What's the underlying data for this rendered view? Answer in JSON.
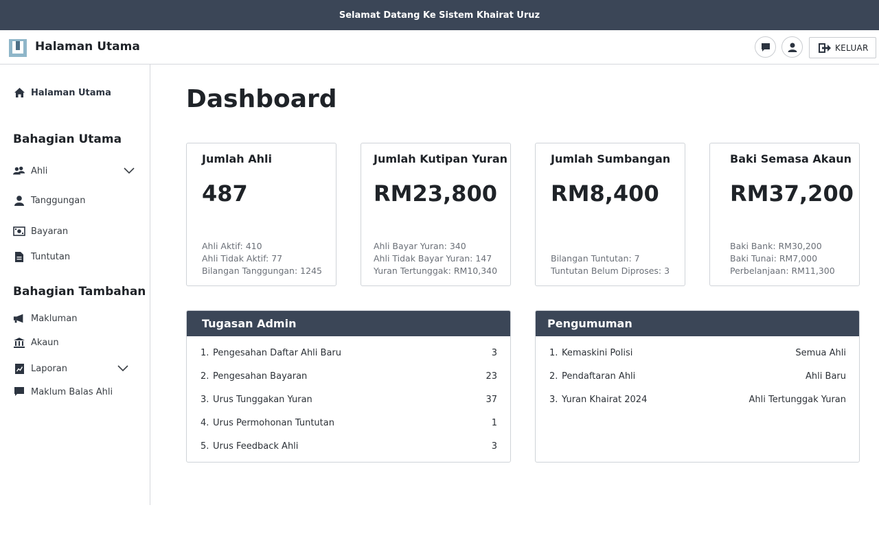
{
  "topbar": {
    "welcome": "Selamat Datang Ke Sistem Khairat Uruz"
  },
  "header": {
    "title": "Halaman Utama",
    "logout_label": "KELUAR",
    "icons": {
      "messages": "chat-icon",
      "profile": "user-icon",
      "logout": "logout-icon"
    }
  },
  "sidebar": {
    "home": {
      "label": "Halaman Utama",
      "icon": "home-icon"
    },
    "section_main": "Bahagian Utama",
    "main_items": [
      {
        "label": "Ahli",
        "icon": "users-icon",
        "expandable": true
      },
      {
        "label": "Tanggungan",
        "icon": "user-icon"
      },
      {
        "label": "Bayaran",
        "icon": "money-icon"
      },
      {
        "label": "Tuntutan",
        "icon": "document-icon"
      }
    ],
    "section_extra": "Bahagian Tambahan",
    "extra_items": [
      {
        "label": "Makluman",
        "icon": "megaphone-icon"
      },
      {
        "label": "Akaun",
        "icon": "bank-icon"
      },
      {
        "label": "Laporan",
        "icon": "report-icon",
        "expandable": true
      },
      {
        "label": "Maklum Balas Ahli",
        "icon": "chat-icon"
      }
    ]
  },
  "main": {
    "title": "Dashboard",
    "cards": [
      {
        "title": "Jumlah Ahli",
        "value": "487",
        "details": [
          "Ahli Aktif: 410",
          "Ahli Tidak Aktif: 77",
          "Bilangan Tanggungan: 1245"
        ]
      },
      {
        "title": "Jumlah Kutipan Yuran",
        "value": "RM23,800",
        "details": [
          "Ahli Bayar Yuran: 340",
          "Ahli Tidak Bayar Yuran: 147",
          "Yuran Tertunggak: RM10,340"
        ]
      },
      {
        "title": "Jumlah Sumbangan",
        "value": "RM8,400",
        "details": [
          "Bilangan Tuntutan: 7",
          "Tuntutan Belum Diproses: 3"
        ]
      },
      {
        "title": "Baki Semasa Akaun",
        "value": "RM37,200",
        "details": [
          "Baki Bank: RM30,200",
          "Baki Tunai: RM7,000",
          "Perbelanjaan: RM11,300"
        ]
      }
    ],
    "admin_tasks": {
      "title": "Tugasan Admin",
      "rows": [
        {
          "num": "1.",
          "label": "Pengesahan Daftar Ahli Baru",
          "value": "3"
        },
        {
          "num": "2.",
          "label": "Pengesahan Bayaran",
          "value": "23"
        },
        {
          "num": "3.",
          "label": "Urus Tunggakan Yuran",
          "value": "37"
        },
        {
          "num": "4.",
          "label": "Urus Permohonan Tuntutan",
          "value": "1"
        },
        {
          "num": "5.",
          "label": "Urus Feedback Ahli",
          "value": "3"
        }
      ]
    },
    "announcements": {
      "title": "Pengumuman",
      "rows": [
        {
          "num": "1.",
          "label": "Kemaskini Polisi",
          "value": "Semua Ahli"
        },
        {
          "num": "2.",
          "label": "Pendaftaran Ahli",
          "value": "Ahli Baru"
        },
        {
          "num": "3.",
          "label": "Yuran Khairat 2024",
          "value": "Ahli Tertunggak Yuran"
        }
      ]
    }
  },
  "colors": {
    "header_dark": "#3b4657",
    "border": "#cfd3d8",
    "muted_text": "#6b7078"
  }
}
